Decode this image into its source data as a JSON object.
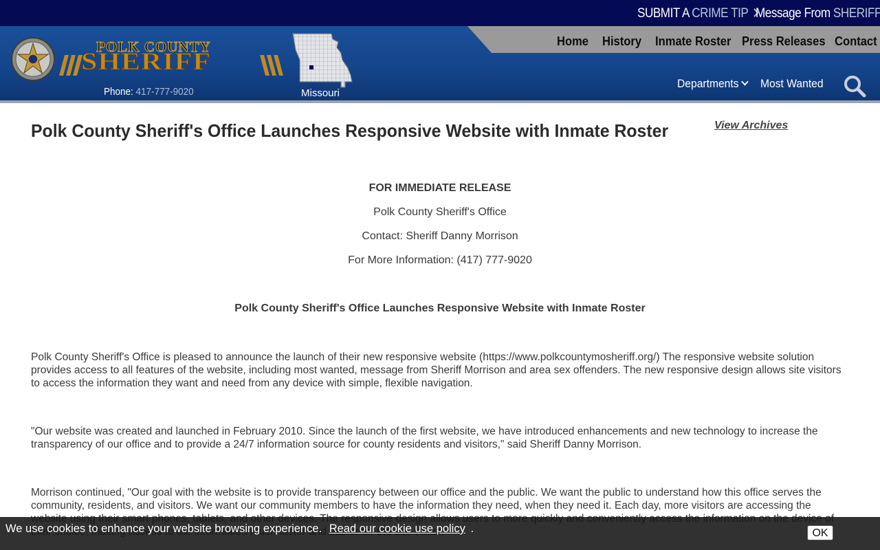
{
  "topbar": {
    "crime_tip_prefix": "SUBMIT A",
    "crime_tip_highlight": "CRIME TIP",
    "sheriff_msg_prefix": "Message From",
    "sheriff_msg_highlight": "SHERIFF"
  },
  "logo": {
    "line1": "POLK COUNTY",
    "line2": "SHERIFF",
    "phone_label": "Phone:",
    "phone_number": "417-777-9020",
    "state_label": "Missouri"
  },
  "nav": {
    "main": [
      "Home",
      "History",
      "Inmate Roster",
      "Press Releases",
      "Contact"
    ],
    "departments": "Departments",
    "most_wanted": "Most Wanted"
  },
  "article": {
    "title": "Polk County Sheriff's Office Launches Responsive Website with Inmate Roster",
    "archives_link": "View Archives",
    "release_label": "FOR IMMEDIATE RELEASE",
    "office": "Polk County Sheriff's Office",
    "contact": "Contact: Sheriff Danny Morrison",
    "more_info": "For More Information: (417) 777-9020",
    "subheading": "Polk County Sheriff's Office Launches Responsive Website with Inmate Roster",
    "paragraphs": [
      "Polk County Sheriff's Office is pleased to announce the launch of their new responsive website (https://www.polkcountymosheriff.org/) The responsive website solution provides access to all features of the website, including most wanted, message from Sheriff Morrison and area sex offenders. The new responsive design allows site visitors to access the information they want and need from any device with simple, flexible navigation.",
      "\"Our website was created and launched in February 2010. Since the launch of the first website, we have introduced enhancements and new technology to increase the transparency of our office and to provide a 24/7 information source for county residents and visitors,\" said Sheriff Danny Morrison.",
      "Morrison continued, \"Our goal with the website is to provide transparency between our office and the public. We want the public to understand how this office serves the community, residents, and visitors. We want our community members to have the information they need, when they need it. Each day, more visitors are accessing the website using their smart phones, tablets, and other devices. The responsive design allows users to more quickly and conveniently access the information on the device of their choice, making access to the information much faster and easier for the site visitor.\""
    ]
  },
  "cookie": {
    "message": "We use cookies to enhance your website browsing experience.",
    "link_text": "Read our cookie use policy",
    "after_link": ".",
    "ok_label": "OK"
  },
  "colors": {
    "topbar": "#050a55",
    "header": "#15458b",
    "nav_tab": "#9a9a9a",
    "logo_gold": "#c08a23"
  }
}
